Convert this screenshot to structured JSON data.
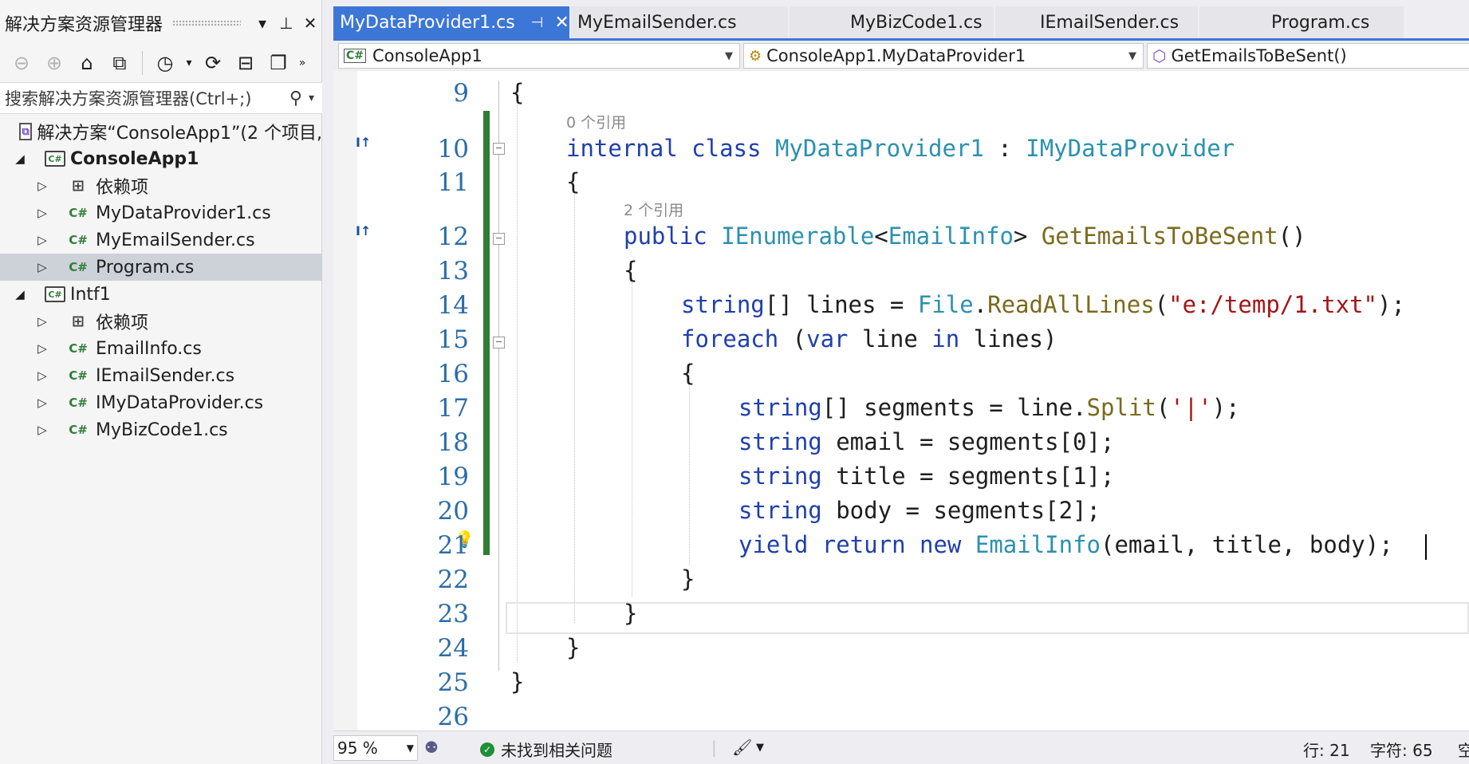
{
  "solution_explorer": {
    "title": "解决方案资源管理器",
    "search_placeholder": "搜索解决方案资源管理器(Ctrl+;)",
    "tree": [
      {
        "label": "解决方案“ConsoleApp1”(2 个项目,",
        "icon": "solution-icon"
      },
      {
        "label": "ConsoleApp1",
        "icon": "csharp-project-icon",
        "expanded": true
      },
      {
        "label": "依赖项",
        "icon": "dependencies-icon"
      },
      {
        "label": "MyDataProvider1.cs",
        "icon": "csharp-file-icon"
      },
      {
        "label": "MyEmailSender.cs",
        "icon": "csharp-file-icon"
      },
      {
        "label": "Program.cs",
        "icon": "csharp-file-icon",
        "selected": true
      },
      {
        "label": "Intf1",
        "icon": "csharp-project-icon",
        "expanded": true
      },
      {
        "label": "依赖项",
        "icon": "dependencies-icon"
      },
      {
        "label": "EmailInfo.cs",
        "icon": "csharp-file-icon"
      },
      {
        "label": "IEmailSender.cs",
        "icon": "csharp-file-icon"
      },
      {
        "label": "IMyDataProvider.cs",
        "icon": "csharp-file-icon"
      },
      {
        "label": "MyBizCode1.cs",
        "icon": "csharp-file-icon"
      }
    ]
  },
  "tabs": [
    {
      "label": "MyDataProvider1.cs",
      "active": true
    },
    {
      "label": "MyEmailSender.cs"
    },
    {
      "label": "MyBizCode1.cs"
    },
    {
      "label": "IEmailSender.cs"
    },
    {
      "label": "Program.cs"
    }
  ],
  "navbar": {
    "project": "ConsoleApp1",
    "type": "ConsoleApp1.MyDataProvider1",
    "member": "GetEmailsToBeSent()"
  },
  "editor": {
    "line_numbers": [
      "9",
      "10",
      "11",
      "12",
      "13",
      "14",
      "15",
      "16",
      "17",
      "18",
      "19",
      "20",
      "21",
      "22",
      "23",
      "24",
      "25",
      "26"
    ],
    "codelens": [
      "0 个引用",
      "2 个引用"
    ],
    "current_line": 21
  },
  "status": {
    "zoom": "95 %",
    "issues": "未找到相关问题",
    "line": "行: 21",
    "col": "字符: 65",
    "tail": "空"
  },
  "colors": {
    "accent": "#3c76d6",
    "keyword": "#1f3fae",
    "type": "#2b91af",
    "method": "#7a6a1c",
    "string": "#a31515",
    "line_number": "#2b6ca8",
    "change_bar": "#2e7d32"
  }
}
